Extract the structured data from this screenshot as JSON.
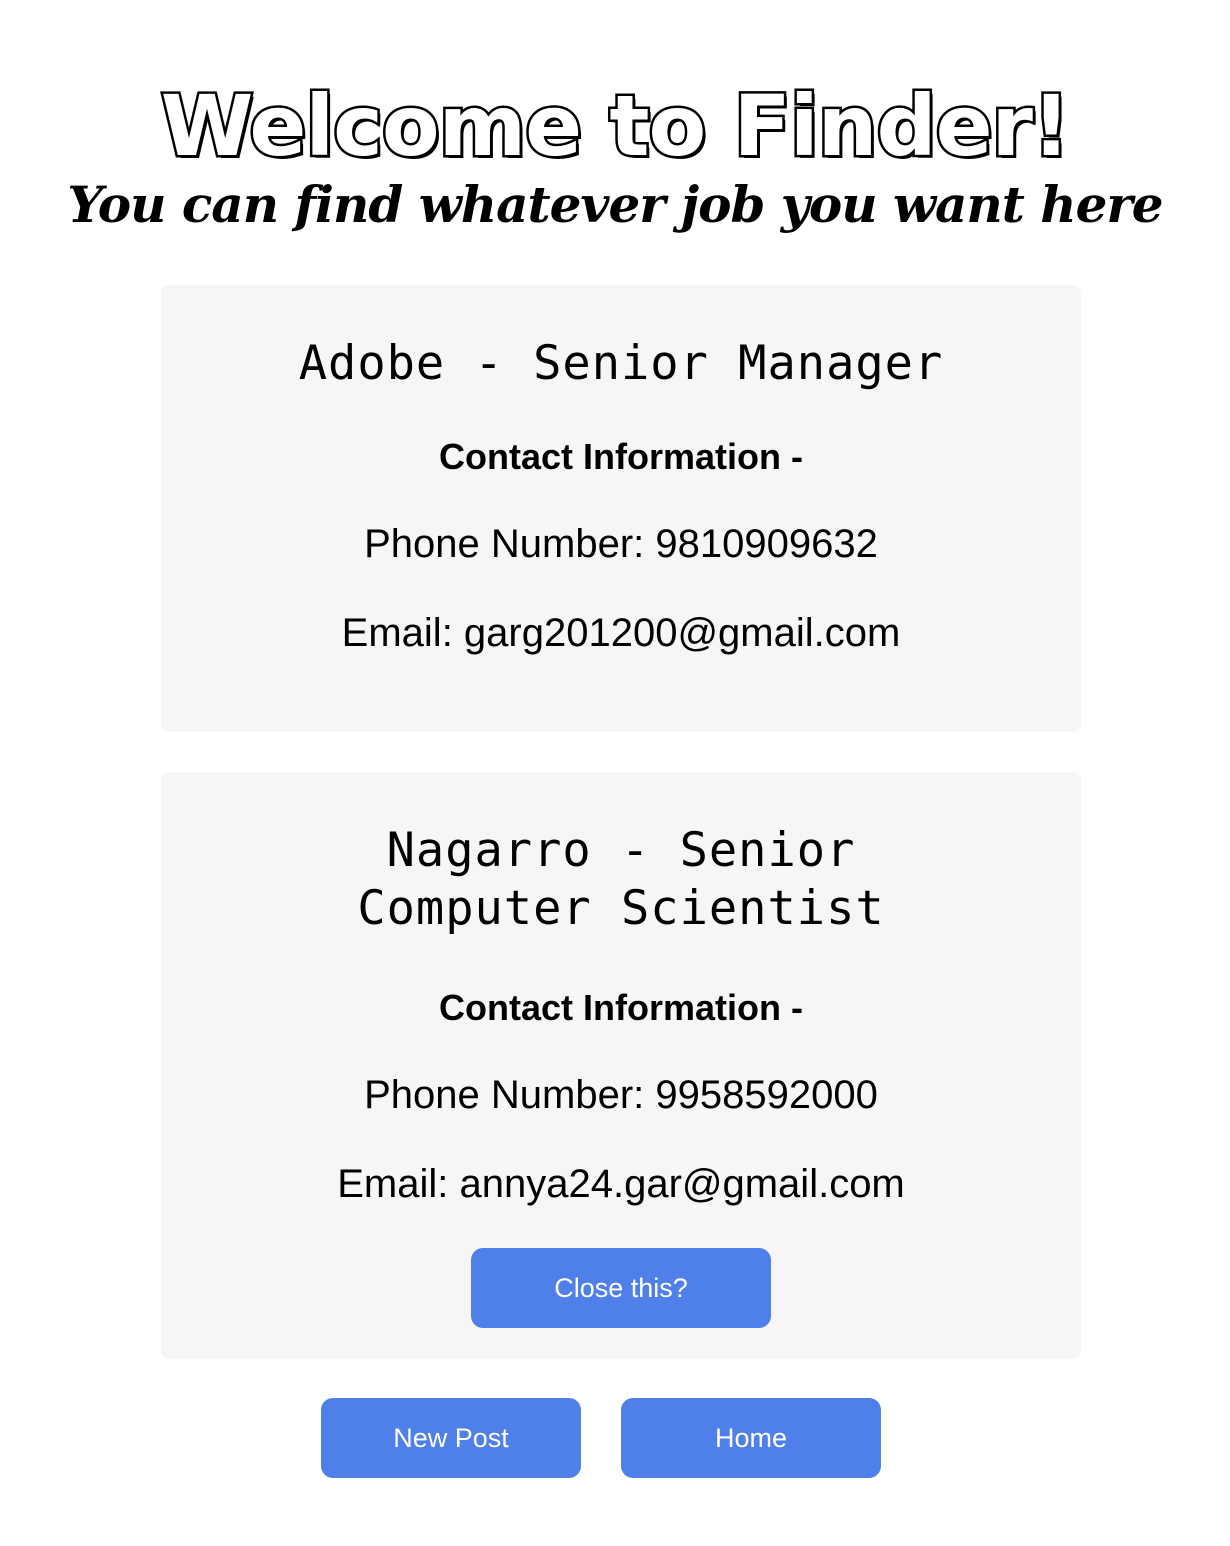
{
  "header": {
    "title": "Welcome to Finder!",
    "subtitle": "You can find whatever job you want here"
  },
  "posts": [
    {
      "title": "Adobe - Senior Manager",
      "contact_heading": "Contact Information -",
      "phone": "Phone Number: 9810909632",
      "email": "Email: garg201200@gmail.com"
    },
    {
      "title": "Nagarro - Senior Computer Scientist",
      "contact_heading": "Contact Information -",
      "phone": "Phone Number: 9958592000",
      "email": "Email: annya24.gar@gmail.com",
      "close_label": "Close this?"
    }
  ],
  "footer": {
    "new_post_label": "New Post",
    "home_label": "Home"
  },
  "colors": {
    "accent": "#4f80ea",
    "card_background": "#f7f5f6"
  }
}
